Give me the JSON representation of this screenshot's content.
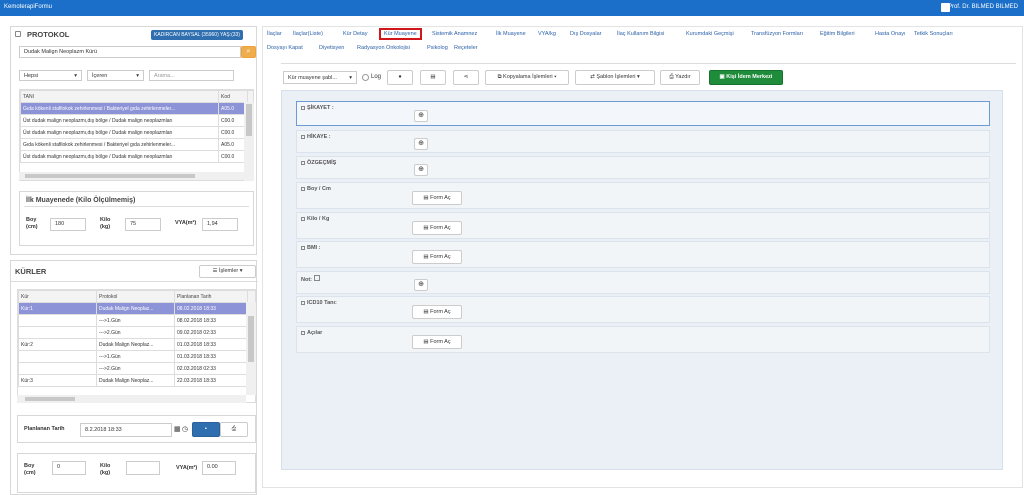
{
  "app": {
    "title": "KemoterapiFormu",
    "user": "Prof. Dr. BILMED BILMED"
  },
  "protokol": {
    "title": "PROTOKOL",
    "badge": "KADIRCAN BAYSAL (35960) YAŞ:(33)",
    "search_value": "Dudak Malign Neoplazm Kürü",
    "filter1": "Hepsi",
    "filter2": "İçeren",
    "search_placeholder": "Arama...",
    "columns": [
      "TANI",
      "Kod"
    ],
    "rows": [
      {
        "tani": "Gıda kökenli stafilokok zehirlenmesi / Bakteriyel gıda zehirlenmeler...",
        "kod": "A05.0",
        "selected": true
      },
      {
        "tani": "Üst dudak malign neoplazmı,dış bölge / Dudak malign neoplazmları",
        "kod": "C00.0",
        "selected": false
      },
      {
        "tani": "Üst dudak malign neoplazmı,dış bölge / Dudak malign neoplazmları",
        "kod": "C00.0",
        "selected": false
      },
      {
        "tani": "Gıda kökenli stafilokok zehirlenmesi / Bakteriyel gıda zehirlenmeler...",
        "kod": "A05.0",
        "selected": false
      },
      {
        "tani": "Üst dudak malign neoplazmı,dış bölge / Dudak malign neoplazmları",
        "kod": "C00.0",
        "selected": false
      }
    ]
  },
  "ilk_muayene": {
    "title": "İlk Muayenede (Kilo Ölçülmemiş)",
    "boy_label": "Boy\n(cm)",
    "boy_value": "180",
    "kilo_label": "Kilo\n(kg)",
    "kilo_value": "75",
    "vya_label": "VYA(m²)",
    "vya_value": "1,94"
  },
  "kurler": {
    "title": "KÜRLER",
    "islemler": "İşlemler",
    "columns": [
      "Kür",
      "Protokol",
      "Planlanan Tarih"
    ],
    "rows": [
      {
        "kur": "Kür:1",
        "protokol": "Dudak Malign Neoplaz...",
        "tarih": "08.02.2018 18:33",
        "selected": true
      },
      {
        "kur": "",
        "protokol": "--->1.Gün",
        "tarih": "08.02.2018 18:33",
        "selected": false
      },
      {
        "kur": "",
        "protokol": "--->2.Gün",
        "tarih": "09.02.2018 02:33",
        "selected": false
      },
      {
        "kur": "Kür:2",
        "protokol": "Dudak Malign Neoplaz...",
        "tarih": "01.03.2018 18:33",
        "selected": false
      },
      {
        "kur": "",
        "protokol": "--->1.Gün",
        "tarih": "01.03.2018 18:33",
        "selected": false
      },
      {
        "kur": "",
        "protokol": "--->2.Gün",
        "tarih": "02.03.2018 02:33",
        "selected": false
      },
      {
        "kur": "Kür:3",
        "protokol": "Dudak Malign Neoplaz...",
        "tarih": "22.03.2018 18:33",
        "selected": false
      }
    ],
    "planlanan_label": "Planlanan Tarih",
    "planlanan_value": "8.2.2018 18:33",
    "boy_label": "Boy\n(cm)",
    "boy_value": "0",
    "kilo_label": "Kilo\n(kg)",
    "kilo_value": "",
    "vya_label": "VYA(m²)",
    "vya_value": "0.00"
  },
  "tabs": [
    {
      "label": "İlaçlar",
      "active": false
    },
    {
      "label": "İlaçlar(Liste)",
      "active": false
    },
    {
      "label": "Kür Detay",
      "active": false
    },
    {
      "label": "Kür Muayene",
      "active": true
    },
    {
      "label": "Sistemik Anamnez",
      "active": false
    },
    {
      "label": "İlk Muayene",
      "active": false
    },
    {
      "label": "VYA/kg",
      "active": false
    },
    {
      "label": "Dış Dosyalar",
      "active": false
    },
    {
      "label": "İlaç Kullanım Bilgisi",
      "active": false
    },
    {
      "label": "Kurumdaki Geçmişi",
      "active": false
    },
    {
      "label": "Transfüzyon Formları",
      "active": false
    },
    {
      "label": "Eğitim Bilgileri",
      "active": false
    },
    {
      "label": "Hasta Onayı",
      "active": false
    },
    {
      "label": "Tetkik Sonuçları",
      "active": false
    }
  ],
  "tabs2": [
    {
      "label": "Dosyayı Kapat"
    },
    {
      "label": "Diyetisyen"
    },
    {
      "label": "Radyasyon Onkolojisi"
    },
    {
      "label": "Psikolog"
    },
    {
      "label": "Reçeteler"
    }
  ],
  "toolbar": {
    "template_select": "Kür muayene şabl...",
    "log_label": "Log",
    "kopyalama": "Kopyalama İşlemleri",
    "sablon": "Şablon İşlemleri",
    "yazdir": "Yazdır",
    "kisi": "Kişi İdem Merkezi"
  },
  "form_rows": [
    {
      "label": "ŞİKAYET :",
      "kind": "plus",
      "first": true
    },
    {
      "label": "HİKAYE :",
      "kind": "plus",
      "first": false
    },
    {
      "label": "ÖZGEÇMİŞ",
      "kind": "plus",
      "first": false
    },
    {
      "label": "Boy / Cm",
      "kind": "form",
      "first": false
    },
    {
      "label": "Kilo / Kg",
      "kind": "form",
      "first": false
    },
    {
      "label": "BMI  :",
      "kind": "form",
      "first": false
    },
    {
      "label": "Not:",
      "kind": "plus",
      "first": false,
      "note": true
    },
    {
      "label": "ICD10 Tanı:",
      "kind": "form",
      "first": false
    },
    {
      "label": "Açılar",
      "kind": "form",
      "first": false
    }
  ],
  "form_button_label": "Form Aç"
}
